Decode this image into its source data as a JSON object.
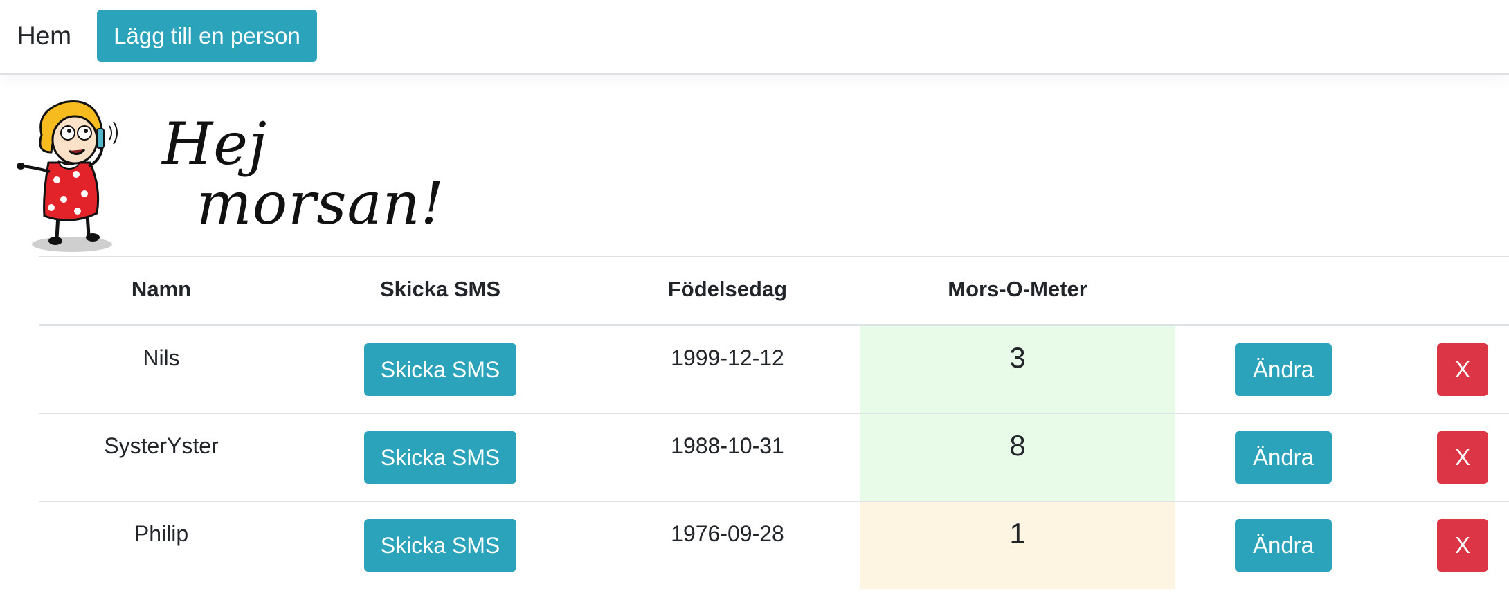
{
  "navbar": {
    "brand": "Hem",
    "add_button": "Lägg till en person"
  },
  "logo": {
    "line1": "Hej",
    "line2": "morsan!",
    "icon": "cartoon-woman-on-phone"
  },
  "table": {
    "headers": [
      "Namn",
      "Skicka SMS",
      "Födelsedag",
      "Mors-O-Meter"
    ],
    "rows": [
      {
        "name": "Nils",
        "sms": "Skicka SMS",
        "birthday": "1999-12-12",
        "meter": "3",
        "meter_color": "#e8fbe9",
        "edit": "Ändra",
        "delete": "X"
      },
      {
        "name": "SysterYster",
        "sms": "Skicka SMS",
        "birthday": "1988-10-31",
        "meter": "8",
        "meter_color": "#e8fbe9",
        "edit": "Ändra",
        "delete": "X"
      },
      {
        "name": "Philip",
        "sms": "Skicka SMS",
        "birthday": "1976-09-28",
        "meter": "1",
        "meter_color": "#fdf5e1",
        "edit": "Ändra",
        "delete": "X"
      }
    ]
  },
  "colors": {
    "info": "#2aa3bb",
    "danger": "#dc3545"
  }
}
